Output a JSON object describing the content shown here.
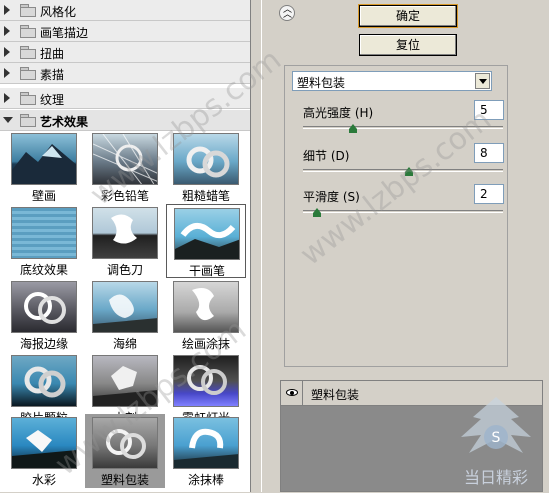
{
  "categories": [
    {
      "label": "风格化",
      "open": false
    },
    {
      "label": "画笔描边",
      "open": false
    },
    {
      "label": "扭曲",
      "open": false
    },
    {
      "label": "素描",
      "open": false
    },
    {
      "label": "纹理",
      "open": false
    },
    {
      "label": "艺术效果",
      "open": true
    }
  ],
  "thumbnails": [
    "壁画",
    "彩色铅笔",
    "粗糙蜡笔",
    "底纹效果",
    "调色刀",
    "干画笔",
    "海报边缘",
    "海绵",
    "绘画涂抹",
    "胶片颗粒",
    "木刻",
    "霓虹灯光",
    "水彩",
    "塑料包装",
    "涂抹棒"
  ],
  "selected_thumbnail": "塑料包装",
  "buttons": {
    "ok": "确定",
    "reset": "复位"
  },
  "collapse_icon": "double-chevron-up-icon",
  "filter_select": {
    "value": "塑料包装"
  },
  "params": [
    {
      "label": "高光强度 (H)",
      "value": "5",
      "fraction": 0.25
    },
    {
      "label": "细节 (D)",
      "value": "8",
      "fraction": 0.53
    },
    {
      "label": "平滑度 (S)",
      "value": "2",
      "fraction": 0.07
    }
  ],
  "layer": {
    "name": "塑料包装",
    "visibility_icon": "eye-icon"
  },
  "watermark": "www.lzbps.com",
  "logo_text": "当日精彩"
}
